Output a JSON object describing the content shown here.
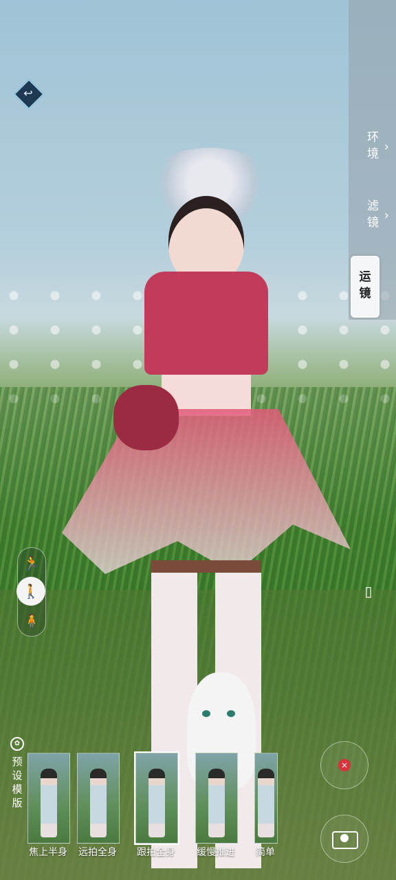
{
  "side_menu": {
    "items": [
      {
        "label_line1": "环",
        "label_line2": "境",
        "has_chevron": true
      },
      {
        "label_line1": "滤",
        "label_line2": "镜",
        "has_chevron": true
      },
      {
        "label_line1": "运",
        "label_line2": "镜",
        "active": true
      }
    ]
  },
  "mode_buttons": {
    "icons": [
      "running-figure-icon",
      "walking-figure-icon",
      "standing-figure-icon"
    ],
    "active_index": 1
  },
  "presets": {
    "header_label": "预设模版",
    "items": [
      {
        "label": "焦上半身",
        "selected": false
      },
      {
        "label": "远拍全身",
        "selected": false
      },
      {
        "label": "跟拍全身",
        "selected": true
      },
      {
        "label": "缓慢推进",
        "selected": false
      },
      {
        "label": "简单",
        "selected": false
      }
    ]
  },
  "glyphs": {
    "back_arrow": "↩",
    "chevron": "›",
    "run": "🏃",
    "walk": "🚶",
    "stand": "🧍",
    "orientation": "▯",
    "record": "×",
    "preset_header_icon": "✿"
  },
  "colors": {
    "record_red": "#d8323c",
    "active_panel_bg": "#f4f6f8"
  }
}
